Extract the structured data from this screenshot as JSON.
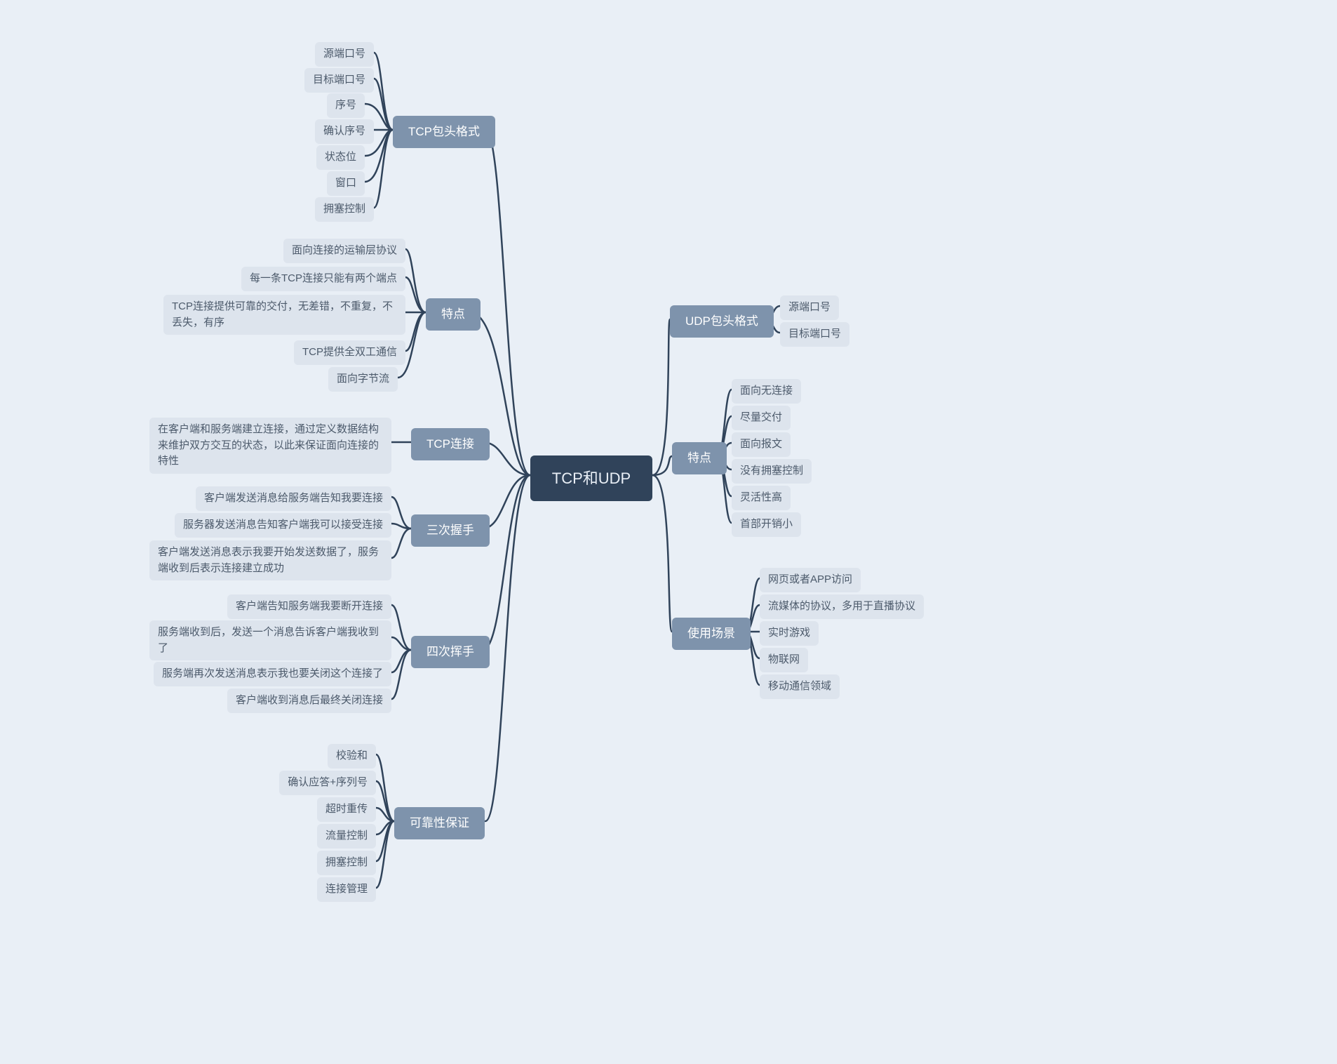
{
  "root": {
    "text": "TCP和UDP"
  },
  "tcp_header": {
    "label": "TCP包头格式",
    "items": [
      "源端口号",
      "目标端口号",
      "序号",
      "确认序号",
      "状态位",
      "窗口",
      "拥塞控制"
    ]
  },
  "tcp_feature": {
    "label": "特点",
    "items": [
      "面向连接的运输层协议",
      "每一条TCP连接只能有两个端点",
      "TCP连接提供可靠的交付，无差错，不重复，不\n丢失，有序",
      "TCP提供全双工通信",
      "面向字节流"
    ]
  },
  "tcp_conn": {
    "label": "TCP连接",
    "items": [
      "在客户端和服务端建立连接，通过定义数据结构\n来维护双方交互的状态，以此来保证面向连接的\n特性"
    ]
  },
  "handshake3": {
    "label": "三次握手",
    "items": [
      "客户端发送消息给服务端告知我要连接",
      "服务器发送消息告知客户端我可以接受连接",
      "客户端发送消息表示我要开始发送数据了，服务\n端收到后表示连接建立成功"
    ]
  },
  "handshake4": {
    "label": "四次挥手",
    "items": [
      "客户端告知服务端我要断开连接",
      "服务端收到后，发送一个消息告诉客户端我收到\n了",
      "服务端再次发送消息表示我也要关闭这个连接了",
      "客户端收到消息后最终关闭连接"
    ]
  },
  "reliability": {
    "label": "可靠性保证",
    "items": [
      "校验和",
      "确认应答+序列号",
      "超时重传",
      "流量控制",
      "拥塞控制",
      "连接管理"
    ]
  },
  "udp_header": {
    "label": "UDP包头格式",
    "items": [
      "源端口号",
      "目标端口号"
    ]
  },
  "udp_feature": {
    "label": "特点",
    "items": [
      "面向无连接",
      "尽量交付",
      "面向报文",
      "没有拥塞控制",
      "灵活性高",
      "首部开销小"
    ]
  },
  "udp_scene": {
    "label": "使用场景",
    "items": [
      "网页或者APP访问",
      "流媒体的协议，多用于直播协议",
      "实时游戏",
      "物联网",
      "移动通信领域"
    ]
  },
  "colors": {
    "connector": "#30435a",
    "root_bg": "#30435a",
    "branch_bg": "#7e93ac",
    "leaf_bg": "#dde4ed",
    "page_bg": "#e9eff6"
  },
  "chart_data": {
    "type": "mindmap",
    "root": "TCP和UDP",
    "left": [
      {
        "label": "TCP包头格式",
        "children": [
          "源端口号",
          "目标端口号",
          "序号",
          "确认序号",
          "状态位",
          "窗口",
          "拥塞控制"
        ]
      },
      {
        "label": "特点",
        "children": [
          "面向连接的运输层协议",
          "每一条TCP连接只能有两个端点",
          "TCP连接提供可靠的交付，无差错，不重复，不丢失，有序",
          "TCP提供全双工通信",
          "面向字节流"
        ]
      },
      {
        "label": "TCP连接",
        "children": [
          "在客户端和服务端建立连接，通过定义数据结构来维护双方交互的状态，以此来保证面向连接的特性"
        ]
      },
      {
        "label": "三次握手",
        "children": [
          "客户端发送消息给服务端告知我要连接",
          "服务器发送消息告知客户端我可以接受连接",
          "客户端发送消息表示我要开始发送数据了，服务端收到后表示连接建立成功"
        ]
      },
      {
        "label": "四次挥手",
        "children": [
          "客户端告知服务端我要断开连接",
          "服务端收到后，发送一个消息告诉客户端我收到了",
          "服务端再次发送消息表示我也要关闭这个连接了",
          "客户端收到消息后最终关闭连接"
        ]
      },
      {
        "label": "可靠性保证",
        "children": [
          "校验和",
          "确认应答+序列号",
          "超时重传",
          "流量控制",
          "拥塞控制",
          "连接管理"
        ]
      }
    ],
    "right": [
      {
        "label": "UDP包头格式",
        "children": [
          "源端口号",
          "目标端口号"
        ]
      },
      {
        "label": "特点",
        "children": [
          "面向无连接",
          "尽量交付",
          "面向报文",
          "没有拥塞控制",
          "灵活性高",
          "首部开销小"
        ]
      },
      {
        "label": "使用场景",
        "children": [
          "网页或者APP访问",
          "流媒体的协议，多用于直播协议",
          "实时游戏",
          "物联网",
          "移动通信领域"
        ]
      }
    ]
  }
}
